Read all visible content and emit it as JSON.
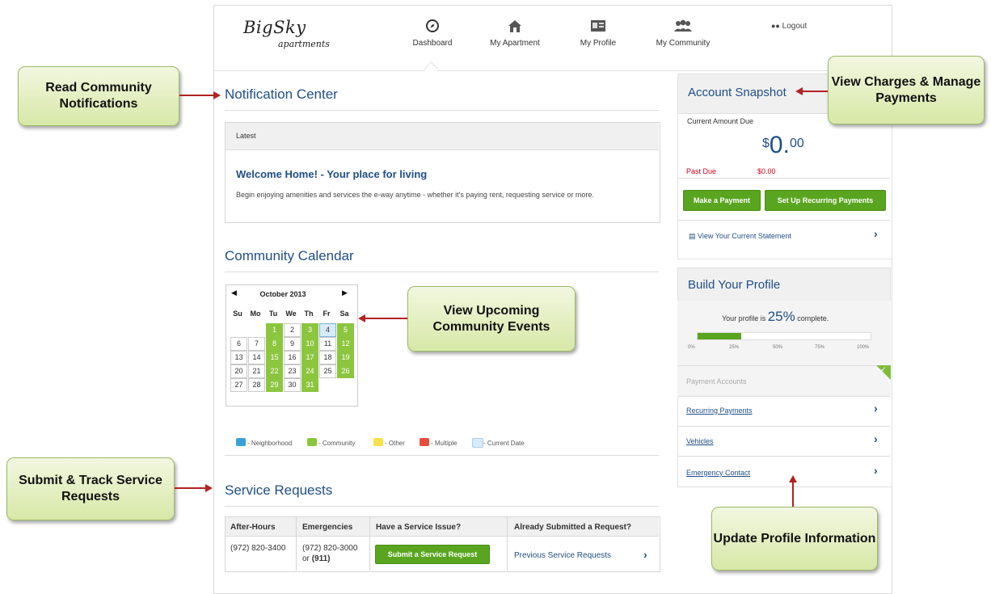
{
  "brand": {
    "logo_main": "BigSky",
    "logo_sub": "apartments"
  },
  "nav": {
    "dashboard": "Dashboard",
    "apartment": "My Apartment",
    "profile": "My Profile",
    "community": "My Community",
    "logout": "Logout"
  },
  "notifications": {
    "title": "Notification Center",
    "latest": "Latest",
    "headline": "Welcome Home! - Your place for living",
    "body": "Begin enjoying amenities and services the e-way anytime - whether it's paying rent, requesting service or more."
  },
  "calendar": {
    "title": "Community Calendar",
    "month": "October 2013",
    "days": [
      "Su",
      "Mo",
      "Tu",
      "We",
      "Th",
      "Fr",
      "Sa"
    ],
    "weeks": [
      [
        "",
        "",
        "1",
        "2",
        "3",
        "4",
        "5"
      ],
      [
        "6",
        "7",
        "8",
        "9",
        "10",
        "11",
        "12"
      ],
      [
        "13",
        "14",
        "15",
        "16",
        "17",
        "18",
        "19"
      ],
      [
        "20",
        "21",
        "22",
        "23",
        "24",
        "25",
        "26"
      ],
      [
        "27",
        "28",
        "29",
        "30",
        "31",
        "",
        ""
      ]
    ],
    "community_days": [
      "1",
      "3",
      "5",
      "8",
      "10",
      "12",
      "15",
      "17",
      "19",
      "22",
      "24",
      "26",
      "29",
      "31"
    ],
    "current_day": "4",
    "legend": [
      "- Neighborhood",
      "- Community",
      "- Other",
      "- Multiple",
      "- Current Date"
    ],
    "legend_colors": [
      "#3aa1d8",
      "#8cc63f",
      "#f8e04a",
      "#e74c3c",
      "#d6ecfa"
    ]
  },
  "service": {
    "title": "Service Requests",
    "headers": [
      "After-Hours",
      "Emergencies",
      "Have a Service Issue?",
      "Already Submitted a Request?"
    ],
    "after_hours": "(972) 820-3400",
    "emergency_line1": "(972) 820-3000",
    "emergency_or": "or",
    "emergency_911": "(911)",
    "submit_button": "Submit a Service Request",
    "previous_link": "Previous Service Requests"
  },
  "account": {
    "title": "Account Snapshot",
    "current_label": "Current Amount Due",
    "currency": "$",
    "amount_whole": "0.",
    "amount_cents": "00",
    "past_due_label": "Past Due",
    "past_due_value": "$0.00",
    "pay_button": "Make a Payment",
    "recurring_button": "Set Up Recurring Payments",
    "statement_link": "View Your Current Statement"
  },
  "profile": {
    "title": "Build Your Profile",
    "progress_prefix": "Your profile is",
    "progress_value": "25%",
    "progress_suffix": "complete.",
    "progress_fraction": 0.25,
    "ticks": [
      "0%",
      "25%",
      "50%",
      "75%",
      "100%"
    ],
    "items": [
      "Payment Accounts",
      "Recurring Payments",
      "Vehicles",
      "Emergency Contact"
    ]
  },
  "callouts": {
    "notifications": "Read Community Notifications",
    "charges": "View Charges & Manage Payments",
    "events": "View Upcoming Community Events",
    "service": "Submit & Track Service Requests",
    "profile": "Update Profile Information"
  },
  "colors": {
    "accent": "#1f4e89",
    "green": "#5aa51f",
    "red": "#d0021b"
  }
}
